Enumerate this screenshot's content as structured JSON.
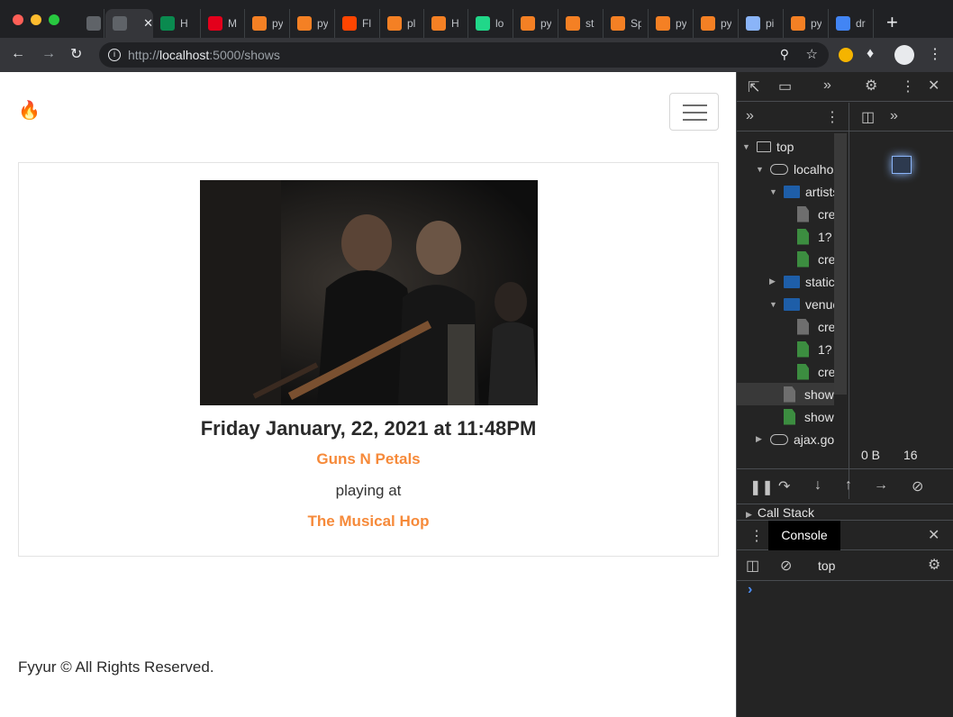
{
  "browser": {
    "tabs": [
      {
        "favicon": "globe-icon",
        "label": "",
        "color": "#5f6368"
      },
      {
        "favicon": "globe-icon",
        "label": "",
        "color": "#5f6368",
        "active": true
      },
      {
        "favicon": "webflow-icon",
        "label": "H",
        "color": "#0a8a4f"
      },
      {
        "favicon": "huawei-icon",
        "label": "M",
        "color": "#e3001b"
      },
      {
        "favicon": "stackoverflow-icon",
        "label": "py",
        "color": "#f48024"
      },
      {
        "favicon": "stackoverflow-icon",
        "label": "py",
        "color": "#f48024"
      },
      {
        "favicon": "reddit-icon",
        "label": "Fl",
        "color": "#ff4500"
      },
      {
        "favicon": "stackoverflow-icon",
        "label": "pl",
        "color": "#f48024"
      },
      {
        "favicon": "stackoverflow-icon",
        "label": "H",
        "color": "#f48024"
      },
      {
        "favicon": "pycharm-icon",
        "label": "lo",
        "color": "#21d789"
      },
      {
        "favicon": "stackoverflow-icon",
        "label": "py",
        "color": "#f48024"
      },
      {
        "favicon": "stackoverflow-icon",
        "label": "st",
        "color": "#f48024"
      },
      {
        "favicon": "stackoverflow-icon",
        "label": "Sp",
        "color": "#f48024"
      },
      {
        "favicon": "stackoverflow-icon",
        "label": "py",
        "color": "#f48024"
      },
      {
        "favicon": "stackoverflow-icon",
        "label": "py",
        "color": "#f48024"
      },
      {
        "favicon": "book-icon",
        "label": "pi",
        "color": "#8ab4f8"
      },
      {
        "favicon": "stackoverflow-icon",
        "label": "py",
        "color": "#f48024"
      },
      {
        "favicon": "google-icon",
        "label": "dr",
        "color": "#4285f4"
      }
    ],
    "url_prefix": "http://",
    "url_host": "localhost",
    "url_rest": ":5000/shows",
    "new_tab": "+"
  },
  "page": {
    "brand_icon": "🔥",
    "show": {
      "start_time": "Friday January, 22, 2021 at 11:48PM",
      "artist_name": "Guns N Petals",
      "playing_at": "playing at",
      "venue_name": "The Musical Hop"
    },
    "footer": "Fyyur © All Rights Reserved."
  },
  "devtools": {
    "tree": [
      {
        "label": "top",
        "indent": 0,
        "kind": "frame",
        "arrow": "▼"
      },
      {
        "label": "localhost",
        "indent": 1,
        "kind": "cloud",
        "arrow": "▼"
      },
      {
        "label": "artists",
        "indent": 2,
        "kind": "folder",
        "arrow": "▼"
      },
      {
        "label": "create",
        "indent": 3,
        "kind": "file-gray"
      },
      {
        "label": "1?",
        "indent": 3,
        "kind": "file-green"
      },
      {
        "label": "create",
        "indent": 3,
        "kind": "file-green"
      },
      {
        "label": "static",
        "indent": 2,
        "kind": "folder",
        "arrow": "▶"
      },
      {
        "label": "venues",
        "indent": 2,
        "kind": "folder",
        "arrow": "▼"
      },
      {
        "label": "create",
        "indent": 3,
        "kind": "file-gray"
      },
      {
        "label": "1?",
        "indent": 3,
        "kind": "file-green"
      },
      {
        "label": "create",
        "indent": 3,
        "kind": "file-green"
      },
      {
        "label": "shows",
        "indent": 2,
        "kind": "file-gray",
        "selected": true
      },
      {
        "label": "shows",
        "indent": 2,
        "kind": "file-green"
      },
      {
        "label": "ajax.googleapis.com",
        "indent": 1,
        "kind": "cloud",
        "arrow": "▶"
      }
    ],
    "bytes": "0 B",
    "bytes2": "16",
    "call_stack": "Call Stack",
    "console_tab": "Console",
    "context": "top",
    "prompt": "›"
  }
}
